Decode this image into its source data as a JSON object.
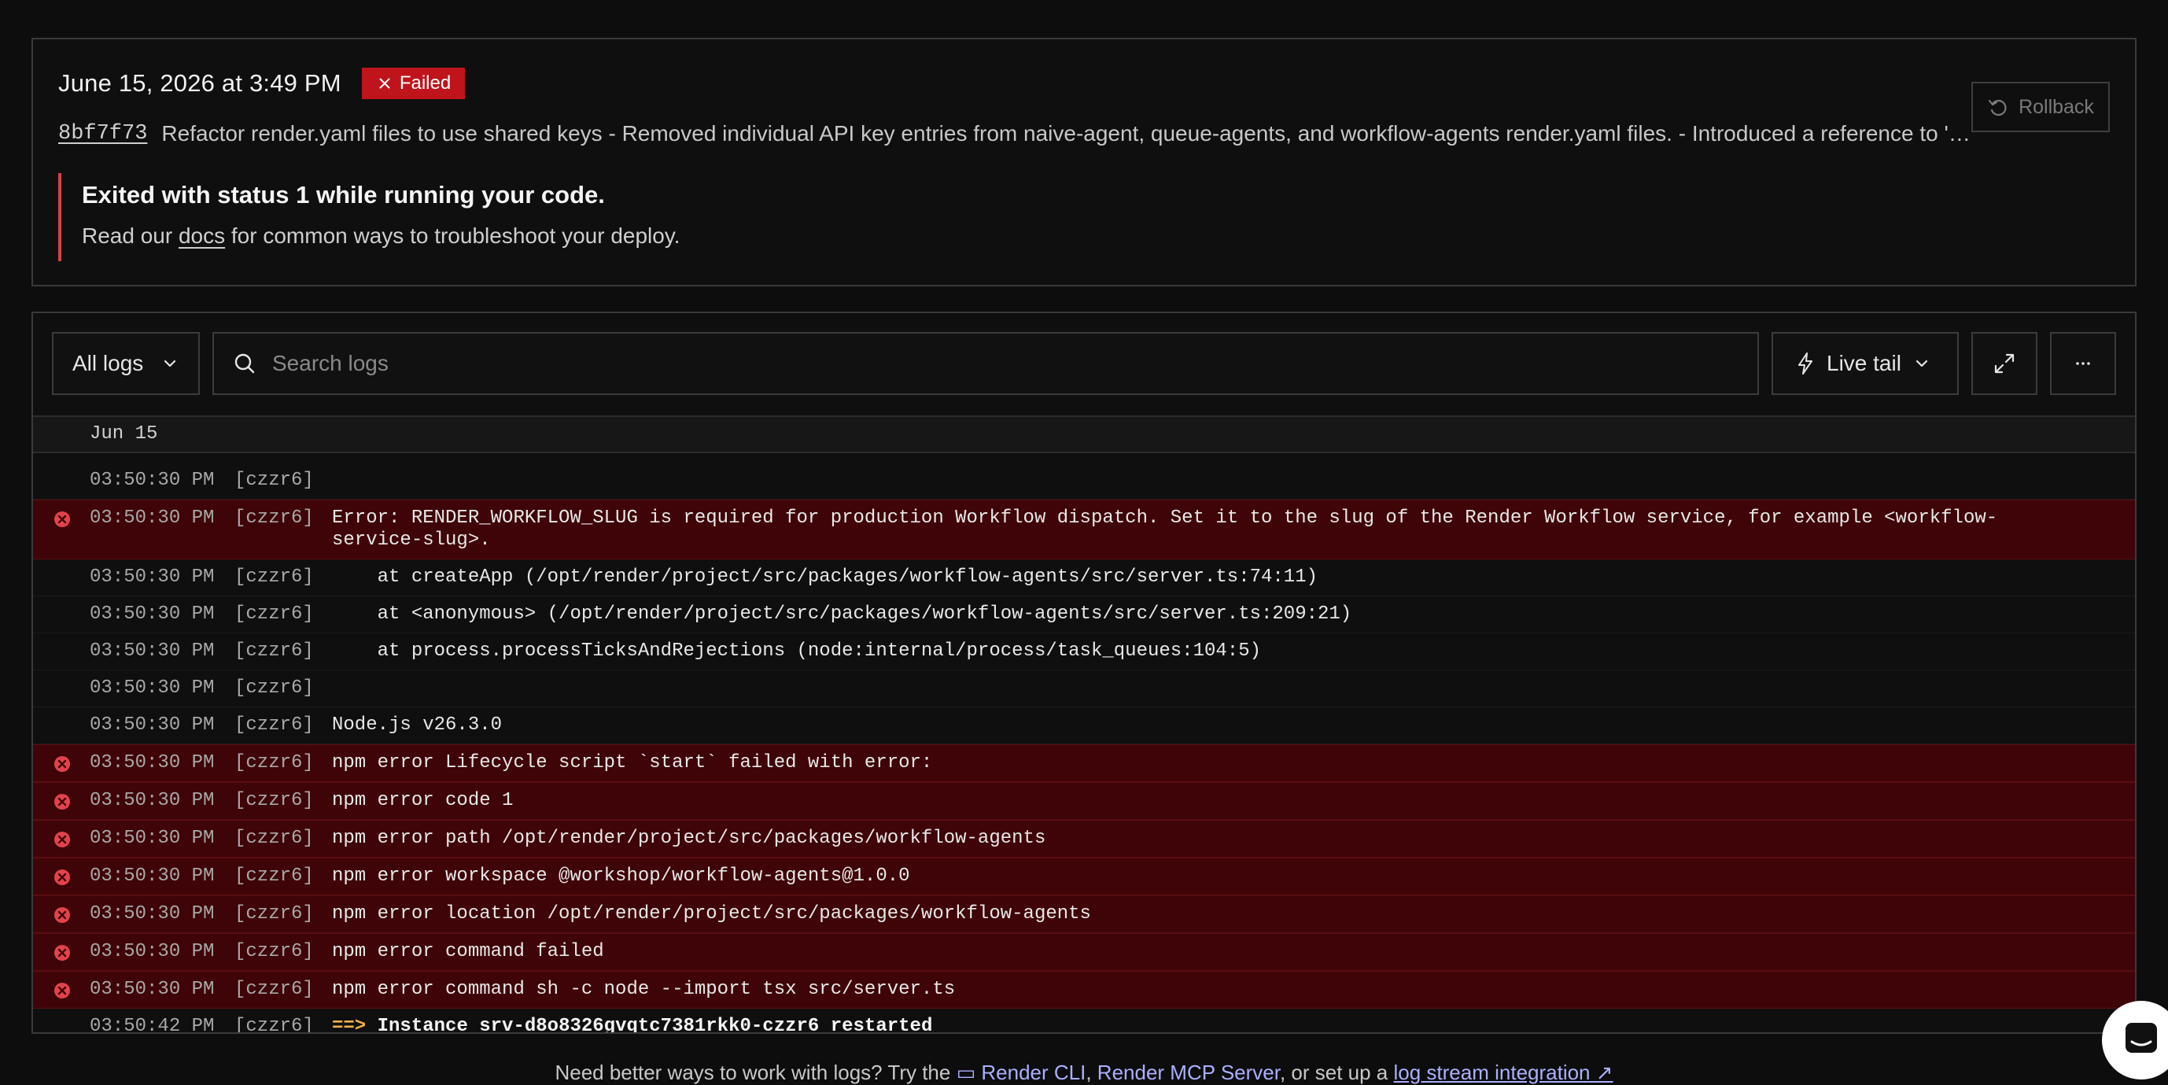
{
  "deploy": {
    "date": "June 15, 2026 at 3:49 PM",
    "status": "Failed",
    "commit_hash": "8bf7f73",
    "commit_message": "Refactor render.yaml files to use shared keys - Removed individual API key entries from naive-agent, queue-agents, and workflow-agents render.yaml files. - Introduced a reference to 'workfl...",
    "rollback_label": "Rollback",
    "error_title": "Exited with status 1 while running your code.",
    "error_desc_prefix": "Read our ",
    "error_desc_link": "docs",
    "error_desc_suffix": " for common ways to troubleshoot your deploy.",
    "colors": {
      "failed": "#c0141c",
      "error_border": "#d4424a"
    }
  },
  "toolbar": {
    "filter_label": "All logs",
    "search_placeholder": "Search logs",
    "live_tail_label": "Live tail",
    "fullscreen_icon": "expand-icon",
    "more_icon": "more-icon"
  },
  "logs": {
    "date_header": "Jun 15",
    "rows": [
      {
        "time": "03:50:30 PM",
        "instance": "[czzr6]",
        "msg": "",
        "error": false
      },
      {
        "time": "03:50:30 PM",
        "instance": "[czzr6]",
        "msg": "Error: RENDER_WORKFLOW_SLUG is required for production Workflow dispatch. Set it to the slug of the Render Workflow service, for example <workflow-service-slug>.",
        "error": true
      },
      {
        "time": "03:50:30 PM",
        "instance": "[czzr6]",
        "msg": "    at createApp (/opt/render/project/src/packages/workflow-agents/src/server.ts:74:11)",
        "error": false
      },
      {
        "time": "03:50:30 PM",
        "instance": "[czzr6]",
        "msg": "    at <anonymous> (/opt/render/project/src/packages/workflow-agents/src/server.ts:209:21)",
        "error": false
      },
      {
        "time": "03:50:30 PM",
        "instance": "[czzr6]",
        "msg": "    at process.processTicksAndRejections (node:internal/process/task_queues:104:5)",
        "error": false
      },
      {
        "time": "03:50:30 PM",
        "instance": "[czzr6]",
        "msg": "",
        "error": false
      },
      {
        "time": "03:50:30 PM",
        "instance": "[czzr6]",
        "msg": "Node.js v26.3.0",
        "error": false
      },
      {
        "time": "03:50:30 PM",
        "instance": "[czzr6]",
        "msg": "npm error Lifecycle script `start` failed with error:",
        "error": true
      },
      {
        "time": "03:50:30 PM",
        "instance": "[czzr6]",
        "msg": "npm error code 1",
        "error": true
      },
      {
        "time": "03:50:30 PM",
        "instance": "[czzr6]",
        "msg": "npm error path /opt/render/project/src/packages/workflow-agents",
        "error": true
      },
      {
        "time": "03:50:30 PM",
        "instance": "[czzr6]",
        "msg": "npm error workspace @workshop/workflow-agents@1.0.0",
        "error": true
      },
      {
        "time": "03:50:30 PM",
        "instance": "[czzr6]",
        "msg": "npm error location /opt/render/project/src/packages/workflow-agents",
        "error": true
      },
      {
        "time": "03:50:30 PM",
        "instance": "[czzr6]",
        "msg": "npm error command failed",
        "error": true
      },
      {
        "time": "03:50:30 PM",
        "instance": "[czzr6]",
        "msg": "npm error command sh -c node --import tsx src/server.ts",
        "error": true
      },
      {
        "time": "03:50:42 PM",
        "instance": "[czzr6]",
        "arrow": "==>",
        "msg": "Instance srv-d8o8326gvqtc7381rkk0-czzr6 restarted",
        "error": false,
        "bold": true
      }
    ]
  },
  "footer": {
    "prefix": "Need better ways to work with logs? Try the ",
    "cli_link": "Render CLI",
    "sep1": ", ",
    "mcp_link": "Render MCP Server",
    "mid": ", or set up a ",
    "stream_link": "log stream integration"
  },
  "chat": {
    "icon": "chat-icon"
  }
}
